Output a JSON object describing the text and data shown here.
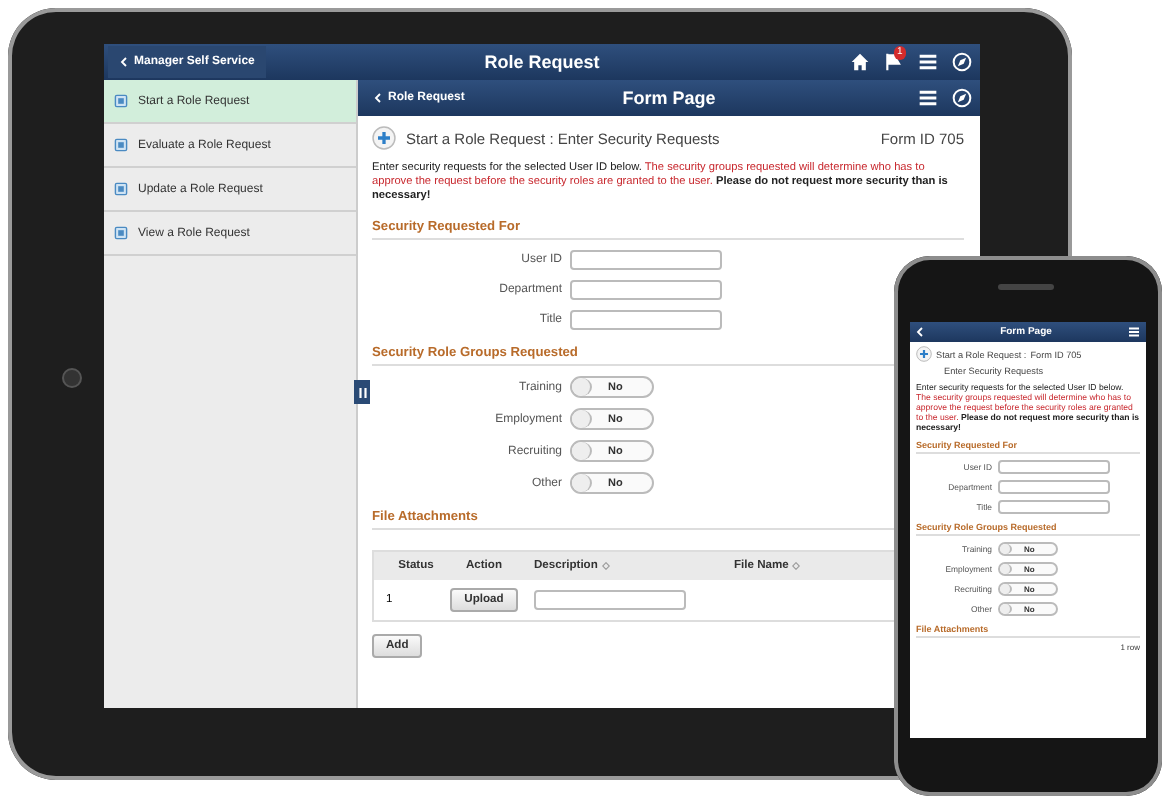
{
  "tablet": {
    "top_bar": {
      "back_label": "Manager Self Service",
      "title": "Role Request",
      "notification_count": "1"
    },
    "sidebar": {
      "items": [
        {
          "label": "Start a Role Request",
          "selected": true
        },
        {
          "label": "Evaluate a Role Request",
          "selected": false
        },
        {
          "label": "Update a Role Request",
          "selected": false
        },
        {
          "label": "View a Role Request",
          "selected": false
        }
      ]
    },
    "sub_header": {
      "back_label": "Role Request",
      "title": "Form Page"
    },
    "page": {
      "heading": "Start a Role Request :  Enter Security Requests",
      "form_id": "Form ID 705",
      "intro": [
        {
          "kind": "plain",
          "text": "Enter security requests for the selected User ID below. "
        },
        {
          "kind": "warning",
          "text": "The security groups requested will determine who has to approve the request before the security roles are granted to the user."
        },
        {
          "kind": "bold",
          "text": " Please do not request more security than is necessary!"
        }
      ],
      "section_1": "Security Requested For",
      "fields": [
        {
          "label": "User ID"
        },
        {
          "label": "Department"
        },
        {
          "label": "Title"
        }
      ],
      "section_2": "Security Role Groups Requested",
      "toggles": [
        {
          "label": "Training",
          "value": "No",
          "on": false
        },
        {
          "label": "Employment",
          "value": "No",
          "on": false
        },
        {
          "label": "Recruiting",
          "value": "No",
          "on": false
        },
        {
          "label": "Other",
          "value": "No",
          "on": false
        }
      ],
      "section_3": "File Attachments",
      "table": {
        "columns": [
          {
            "label": "Status",
            "sortable": false
          },
          {
            "label": "Action",
            "sortable": false
          },
          {
            "label": "Description",
            "sortable": true
          },
          {
            "label": "File Name",
            "sortable": true
          }
        ],
        "rows": [
          {
            "status": "1",
            "action": "Upload"
          }
        ]
      },
      "add_button": "Add"
    }
  },
  "phone": {
    "header": {
      "title": "Form Page"
    },
    "page": {
      "heading": "Start a Role Request :",
      "form_id": "Form ID 705",
      "subheading": "Enter Security Requests",
      "intro": [
        {
          "kind": "plain",
          "text": "Enter security requests for the selected User ID below. "
        },
        {
          "kind": "warning",
          "text": "The security groups requested will determine who has to approve the request before the security roles are granted to the user."
        },
        {
          "kind": "bold",
          "text": " Please do not request more security than is necessary!"
        }
      ],
      "section_1": "Security Requested For",
      "fields": [
        {
          "label": "User ID"
        },
        {
          "label": "Department"
        },
        {
          "label": "Title"
        }
      ],
      "section_2": "Security Role Groups Requested",
      "toggles": [
        {
          "label": "Training",
          "value": "No",
          "on": false
        },
        {
          "label": "Employment",
          "value": "No",
          "on": false
        },
        {
          "label": "Recruiting",
          "value": "No",
          "on": false
        },
        {
          "label": "Other",
          "value": "No",
          "on": false
        }
      ],
      "section_3": "File Attachments",
      "row_count": "1 row"
    }
  }
}
